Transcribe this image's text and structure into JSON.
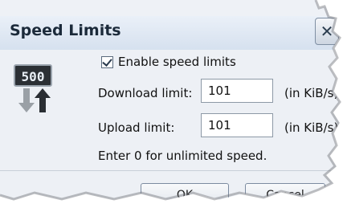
{
  "dialog": {
    "title": "Speed Limits",
    "close_glyph": "✕"
  },
  "icon": {
    "name": "speed-limit-icon",
    "display_value": "500"
  },
  "enable": {
    "label": "Enable speed limits",
    "checked": true
  },
  "download": {
    "label": "Download limit:",
    "value": "101",
    "unit": "(in KiB/s)"
  },
  "upload": {
    "label": "Upload limit:",
    "value": "101",
    "unit": "(in KiB/s)"
  },
  "hint": "Enter 0 for unlimited speed.",
  "buttons": {
    "ok": "OK",
    "cancel": "Cancel"
  }
}
